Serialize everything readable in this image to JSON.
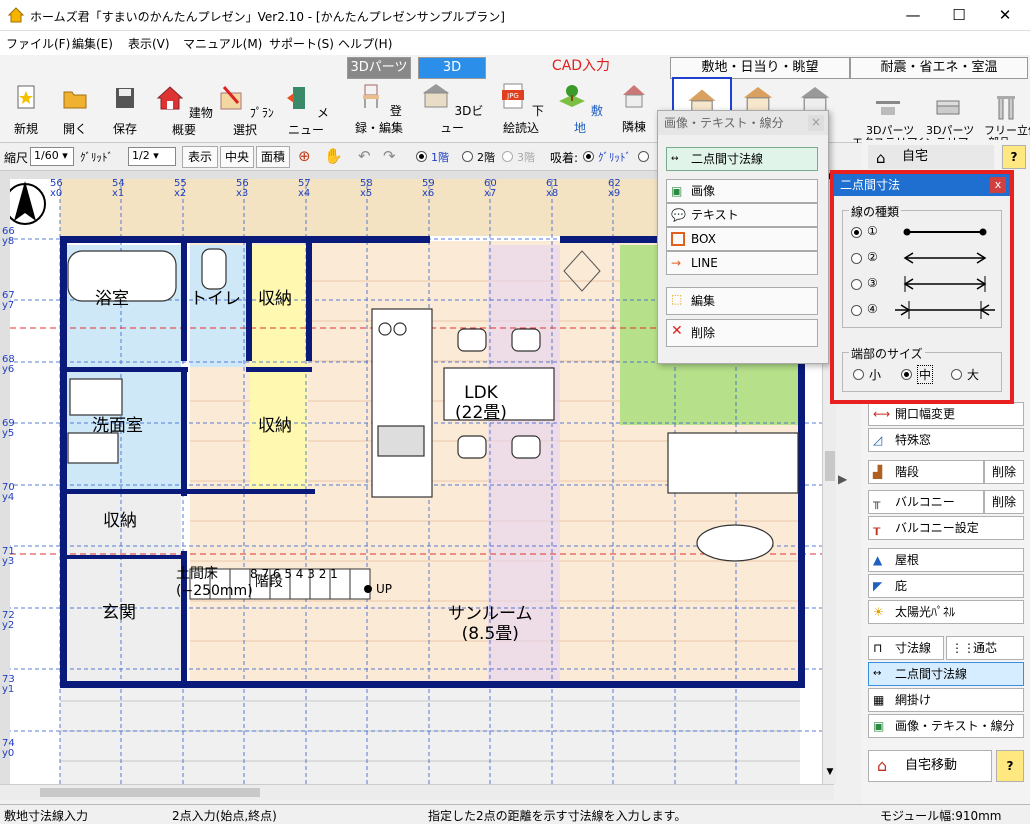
{
  "window": {
    "title": "ホームズ君「すまいのかんたんプレゼン」Ver2.10 - [かんたんプレゼンサンプルプラン]",
    "min": "—",
    "max": "☐",
    "close": "✕"
  },
  "menu": [
    "ファイル(F)",
    "編集(E)",
    "表示(V)",
    "マニュアル(M)",
    "サポート(S)",
    "ヘルプ(H)"
  ],
  "toolbar": {
    "buttons": [
      "新規",
      "開く",
      "保存",
      "建物概要",
      "ﾌﾟﾗﾝ選択",
      "メニュー"
    ],
    "parts3d_tab": "3Dパーツ",
    "parts3d_btn": "登録・編集",
    "view3d_tab": "3D",
    "view3d_btn": "3Dビュー",
    "cad_tab": "CAD入力",
    "site_tab": "敷地・日当り・眺望",
    "eco_tab": "耐震・省エネ・室温",
    "cad_buttons": [
      "下絵読込",
      "敷地",
      "隣棟"
    ],
    "right_buttons": [
      "3Dパーツ\nエクステリア",
      "3Dパーツ\nインテリア",
      "フリー立体\n部品"
    ]
  },
  "toolbar2": {
    "scale_label": "縮尺",
    "scale_value": "1/60",
    "grid_label": "ｸﾞﾘｯﾄﾞ",
    "grid_value": "1/2",
    "display": "表示",
    "center": "中央",
    "area": "面積",
    "floor1": "1階",
    "floor2": "2階",
    "floor3": "3階",
    "snap_label": "吸着:",
    "snap_grid": "ｸﾞﾘｯﾄﾞ"
  },
  "plan": {
    "top_ruler": [
      "56\nx0",
      "54\nx1",
      "55\nx2",
      "56\nx3",
      "57\nx4",
      "58\nx5",
      "59\nx6",
      "60\nx7",
      "61\nx8",
      "62\nx9"
    ],
    "left_ruler": [
      "66\ny8",
      "67\ny7",
      "68\ny6",
      "69\ny5",
      "70\ny4",
      "71\ny3",
      "72\ny2",
      "73\ny1",
      "74\ny0"
    ],
    "rooms": {
      "bath": "浴室",
      "toilet": "トイレ",
      "storage1": "収納",
      "washroom": "洗面室",
      "storage2": "収納",
      "ldk": "LDK\n(22畳)",
      "storage3": "収納",
      "dirt_floor": "土間床\n(−250mm)",
      "stairs": "階段",
      "stair_nums": "8 7 6 5 4 3 2 1",
      "up": "UP",
      "entrance": "玄関",
      "sunroom": "サンルーム\n(8.5畳)"
    }
  },
  "image_popup": {
    "title": "画像・テキスト・線分",
    "close": "×",
    "dim_btn": "二点間寸法線",
    "items": [
      "画像",
      "テキスト",
      "BOX",
      "LINE"
    ],
    "edit": "編集",
    "delete": "削除"
  },
  "dim_dialog": {
    "title": "二点間寸法",
    "close": "x",
    "line_type_label": "線の種類",
    "options": [
      "①",
      "②",
      "③",
      "④"
    ],
    "end_size_label": "端部のサイズ",
    "sizes": [
      "小",
      "中",
      "大"
    ],
    "selected_size": "中"
  },
  "right_panel": {
    "home_label": "自宅",
    "help": "?",
    "buttons": [
      "開口幅変更",
      "特殊窓",
      "階段",
      "バルコニー",
      "バルコニー設定",
      "屋根",
      "庇",
      "太陽光ﾊﾟﾈﾙ",
      "寸法線",
      "通芯",
      "二点間寸法線",
      "網掛け",
      "画像・テキスト・線分"
    ],
    "delete1": "削除",
    "delete2": "削除",
    "move": "自宅移動"
  },
  "status": {
    "left": "敷地寸法線入力",
    "mid": "2点入力(始点,終点)",
    "msg": "指定した2点の距離を示す寸法線を入力します。",
    "module": "モジュール幅:910mm"
  },
  "colors": {
    "accent": "#1f6fd0",
    "highlight_border": "#e82020",
    "wall": "#0a1a7a",
    "floor": "#f8e6d0",
    "grid": "#3060d0"
  }
}
